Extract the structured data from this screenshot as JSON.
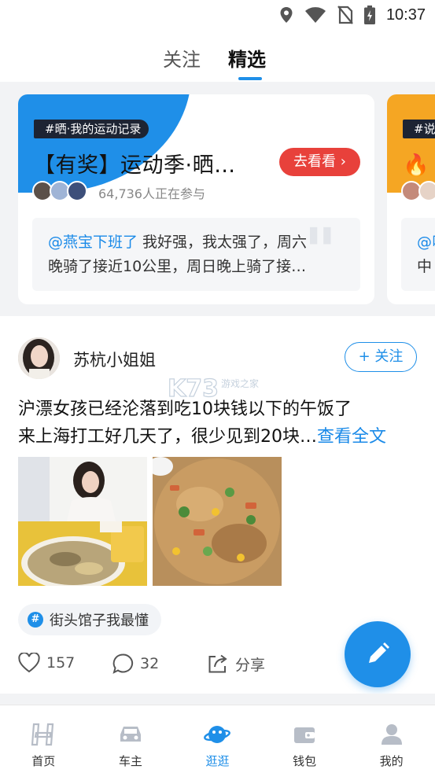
{
  "status_bar": {
    "time": "10:37",
    "icons": [
      "location-icon",
      "wifi-icon",
      "no-sim-icon",
      "battery-charging-icon"
    ]
  },
  "tabs": {
    "follow": "关注",
    "featured": "精选",
    "active": "featured"
  },
  "topic_cards": [
    {
      "tag": "#晒·我的运动记录",
      "title": "【有奖】运动季·晒…",
      "button": "去看看",
      "participants": "64,736人正在参与",
      "quote_user": "@燕宝下班了",
      "quote_line1": " 我好强，我太强了，周六",
      "quote_line2": "晚骑了接近10公里，周日晚上骑了接…",
      "accent_color": "#1f8fe8"
    },
    {
      "tag": "#说",
      "title": "🔥 口",
      "quote_user": "@叫",
      "quote_line2": "中",
      "accent_color": "#f5a623"
    }
  ],
  "post": {
    "author": "苏杭小姐姐",
    "follow_label": "+ 关注",
    "title": "沪漂女孩已经沦落到吃10块钱以下的午饭了",
    "body": "来上海打工好几天了，很少见到20块…",
    "read_more": "查看全文",
    "watermark": "K73 游戏之家",
    "hashtag": "街头馆子我最懂",
    "likes": "157",
    "comments": "32",
    "share_label": "分享"
  },
  "bottom_nav": [
    {
      "label": "首页",
      "icon": "home-icon"
    },
    {
      "label": "车主",
      "icon": "car-icon"
    },
    {
      "label": "逛逛",
      "icon": "planet-icon",
      "active": true
    },
    {
      "label": "钱包",
      "icon": "wallet-icon"
    },
    {
      "label": "我的",
      "icon": "profile-icon"
    }
  ],
  "colors": {
    "brand_blue": "#1f8fe8",
    "button_red": "#e8413b",
    "background_gray": "#f2f3f5"
  }
}
